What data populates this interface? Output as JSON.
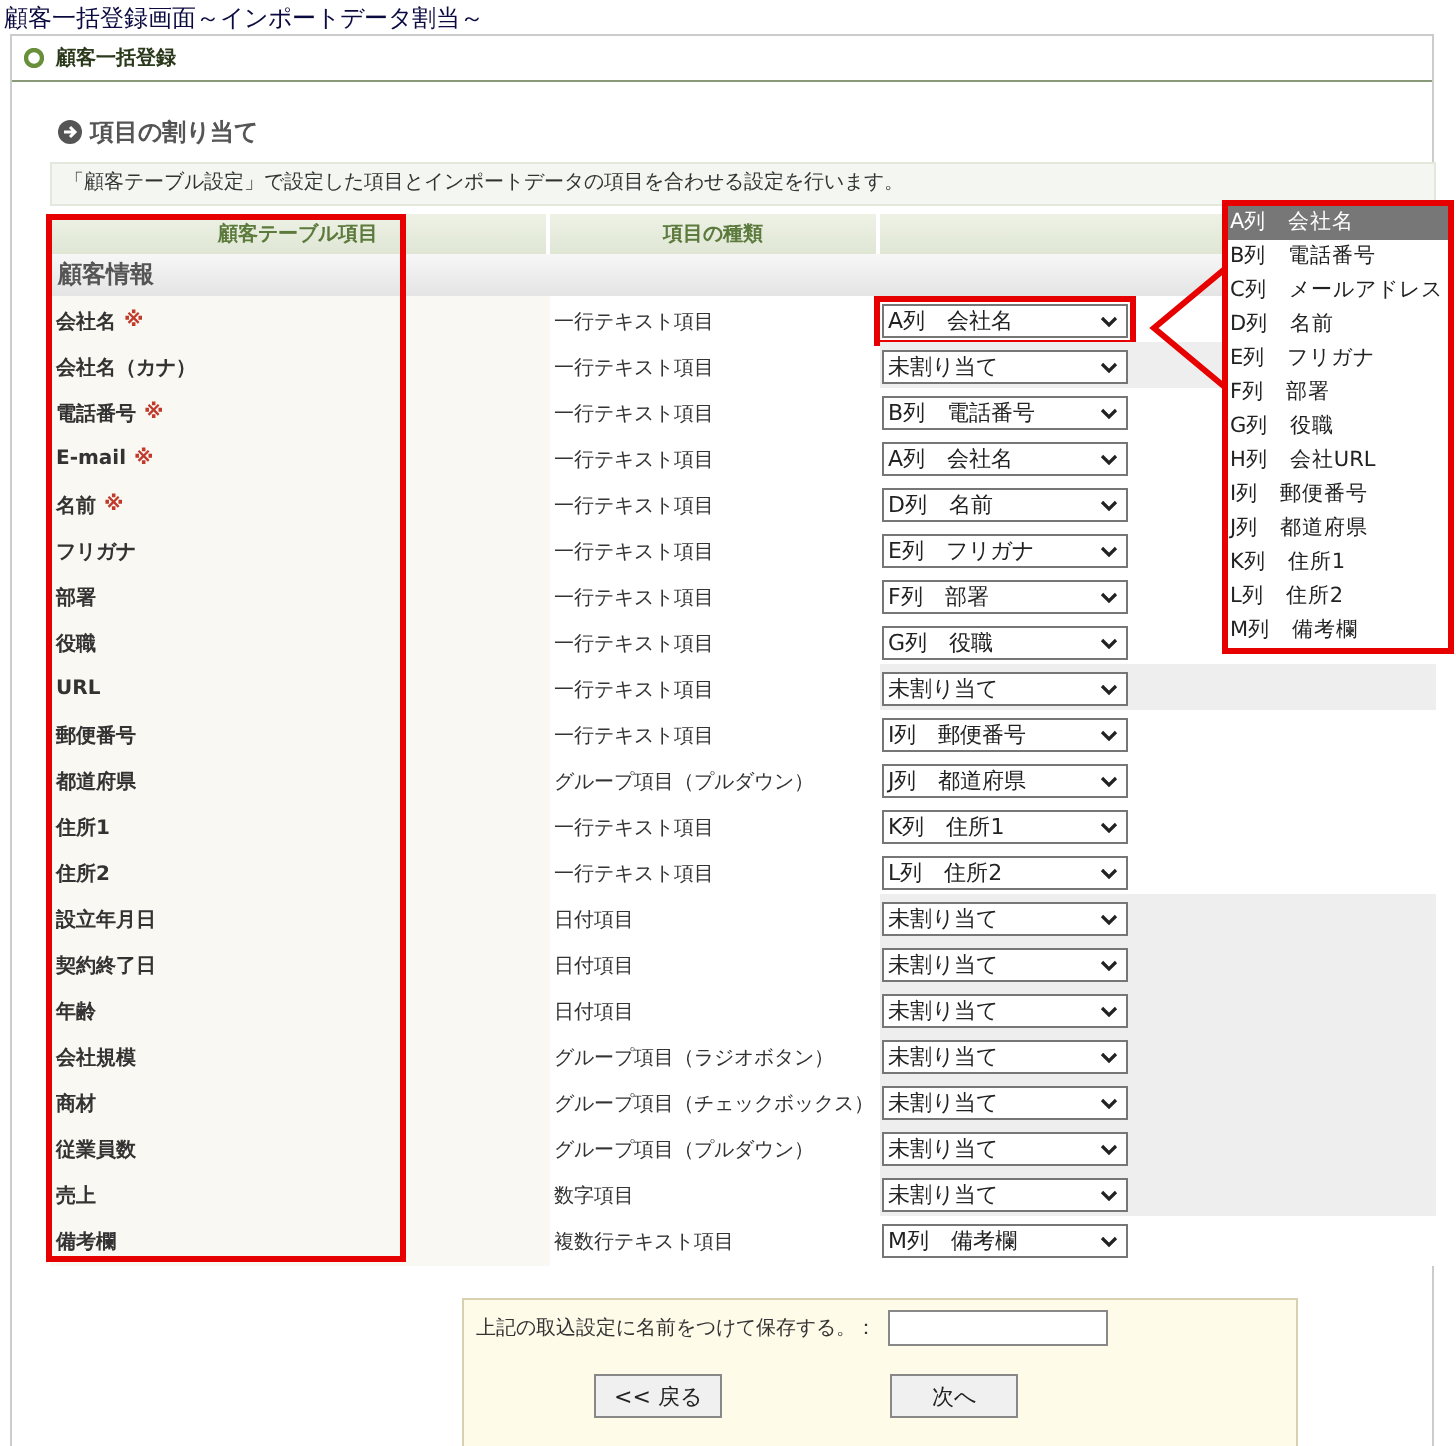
{
  "page_title": "顧客一括登録画面～インポートデータ割当～",
  "panel": {
    "title": "顧客一括登録"
  },
  "section": {
    "title": "項目の割り当て",
    "description": "「顧客テーブル設定」で設定した項目とインポートデータの項目を合わせる設定を行います。"
  },
  "table": {
    "columns": [
      "顧客テーブル項目",
      "項目の種類"
    ],
    "group": "顧客情報",
    "rows": [
      {
        "name": "会社名",
        "required": true,
        "type": "一行テキスト項目",
        "mapping": "A列　会社名",
        "unassigned": false,
        "annotated": true
      },
      {
        "name": "会社名（カナ）",
        "required": false,
        "type": "一行テキスト項目",
        "mapping": "未割り当て",
        "unassigned": true,
        "annotated": false
      },
      {
        "name": "電話番号",
        "required": true,
        "type": "一行テキスト項目",
        "mapping": "B列　電話番号",
        "unassigned": false,
        "annotated": false
      },
      {
        "name": "E-mail",
        "required": true,
        "type": "一行テキスト項目",
        "mapping": "A列　会社名",
        "unassigned": false,
        "annotated": false
      },
      {
        "name": "名前",
        "required": true,
        "type": "一行テキスト項目",
        "mapping": "D列　名前",
        "unassigned": false,
        "annotated": false
      },
      {
        "name": "フリガナ",
        "required": false,
        "type": "一行テキスト項目",
        "mapping": "E列　フリガナ",
        "unassigned": false,
        "annotated": false
      },
      {
        "name": "部署",
        "required": false,
        "type": "一行テキスト項目",
        "mapping": "F列　部署",
        "unassigned": false,
        "annotated": false
      },
      {
        "name": "役職",
        "required": false,
        "type": "一行テキスト項目",
        "mapping": "G列　役職",
        "unassigned": false,
        "annotated": false
      },
      {
        "name": "URL",
        "required": false,
        "type": "一行テキスト項目",
        "mapping": "未割り当て",
        "unassigned": true,
        "annotated": false
      },
      {
        "name": "郵便番号",
        "required": false,
        "type": "一行テキスト項目",
        "mapping": "I列　郵便番号",
        "unassigned": false,
        "annotated": false
      },
      {
        "name": "都道府県",
        "required": false,
        "type": "グループ項目（プルダウン）",
        "mapping": "J列　都道府県",
        "unassigned": false,
        "annotated": false
      },
      {
        "name": "住所1",
        "required": false,
        "type": "一行テキスト項目",
        "mapping": "K列　住所1",
        "unassigned": false,
        "annotated": false
      },
      {
        "name": "住所2",
        "required": false,
        "type": "一行テキスト項目",
        "mapping": "L列　住所2",
        "unassigned": false,
        "annotated": false
      },
      {
        "name": "設立年月日",
        "required": false,
        "type": "日付項目",
        "mapping": "未割り当て",
        "unassigned": true,
        "annotated": false
      },
      {
        "name": "契約終了日",
        "required": false,
        "type": "日付項目",
        "mapping": "未割り当て",
        "unassigned": true,
        "annotated": false
      },
      {
        "name": "年齢",
        "required": false,
        "type": "日付項目",
        "mapping": "未割り当て",
        "unassigned": true,
        "annotated": false
      },
      {
        "name": "会社規模",
        "required": false,
        "type": "グループ項目（ラジオボタン）",
        "mapping": "未割り当て",
        "unassigned": true,
        "annotated": false
      },
      {
        "name": "商材",
        "required": false,
        "type": "グループ項目（チェックボックス）",
        "mapping": "未割り当て",
        "unassigned": true,
        "annotated": false
      },
      {
        "name": "従業員数",
        "required": false,
        "type": "グループ項目（プルダウン）",
        "mapping": "未割り当て",
        "unassigned": true,
        "annotated": false
      },
      {
        "name": "売上",
        "required": false,
        "type": "数字項目",
        "mapping": "未割り当て",
        "unassigned": true,
        "annotated": false
      },
      {
        "name": "備考欄",
        "required": false,
        "type": "複数行テキスト項目",
        "mapping": "M列　備考欄",
        "unassigned": false,
        "annotated": false
      }
    ]
  },
  "required_mark": "※",
  "dropdown": {
    "options": [
      {
        "label": "A列　会社名",
        "selected": true
      },
      {
        "label": "B列　電話番号",
        "selected": false
      },
      {
        "label": "C列　メールアドレス",
        "selected": false
      },
      {
        "label": "D列　名前",
        "selected": false
      },
      {
        "label": "E列　フリガナ",
        "selected": false
      },
      {
        "label": "F列　部署",
        "selected": false
      },
      {
        "label": "G列　役職",
        "selected": false
      },
      {
        "label": "H列　会社URL",
        "selected": false
      },
      {
        "label": "I列　郵便番号",
        "selected": false
      },
      {
        "label": "J列　都道府県",
        "selected": false
      },
      {
        "label": "K列　住所1",
        "selected": false
      },
      {
        "label": "L列　住所2",
        "selected": false
      },
      {
        "label": "M列　備考欄",
        "selected": false
      }
    ]
  },
  "save": {
    "label": "上記の取込設定に名前をつけて保存する。："
  },
  "buttons": [
    "<< 戻る",
    "次へ"
  ]
}
